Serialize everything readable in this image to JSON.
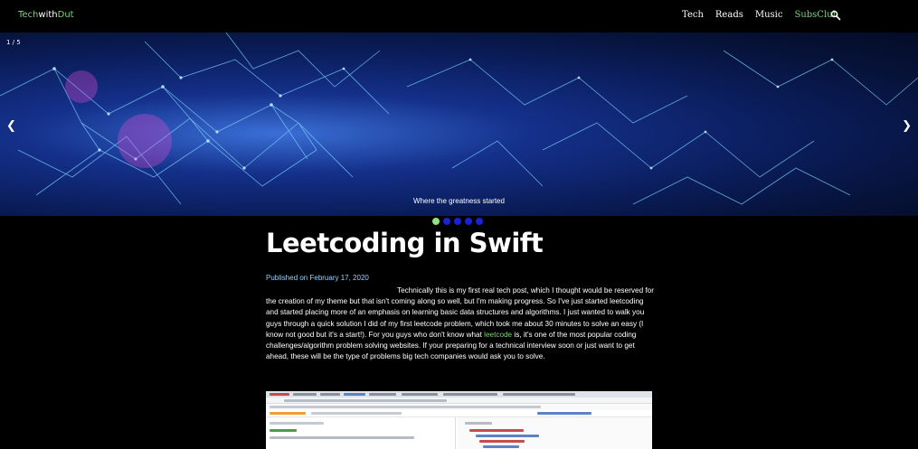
{
  "nav": {
    "logo": {
      "part1": "Tech",
      "part2": "with",
      "part3": "Dut"
    },
    "links": [
      "Tech",
      "Reads",
      "Music",
      "SubsClub"
    ],
    "active_link": "SubsClub",
    "search_icon": "search-icon"
  },
  "hero": {
    "counter": "1 / 5",
    "caption": "Where the greatness started",
    "prev_icon": "chevron-left-icon",
    "next_icon": "chevron-right-icon",
    "dots_count": 5,
    "active_dot": 0
  },
  "article": {
    "title": "Leetcoding in Swift",
    "published": "Published on February 17, 2020",
    "body_before_link": "Technically this is my first real tech post, which I thought would be reserved for the creation of my theme but that isn't coming along so well, but I'm making progress. So I've just started leetcoding and started placing more of an emphasis on learning basic data structures and algorithms. I just wanted to walk you guys through a quick solution I did of my first leetcode problem, which took me about 30 minutes to solve an easy (I know not good but it's a start!). For you guys who don't know what ",
    "link_text": "leetcode",
    "body_after_link": " is, it's one of the most popular coding challenges/algorithm problem solving websites. If your preparing for a technical interview soon or just want to get ahead, these will be the type of problems big tech companies would ask you to solve."
  },
  "colors": {
    "accent_green": "#7ed37a",
    "published_blue": "#9ad0ff",
    "dot_blue": "#1a22d8",
    "background": "#000000"
  }
}
